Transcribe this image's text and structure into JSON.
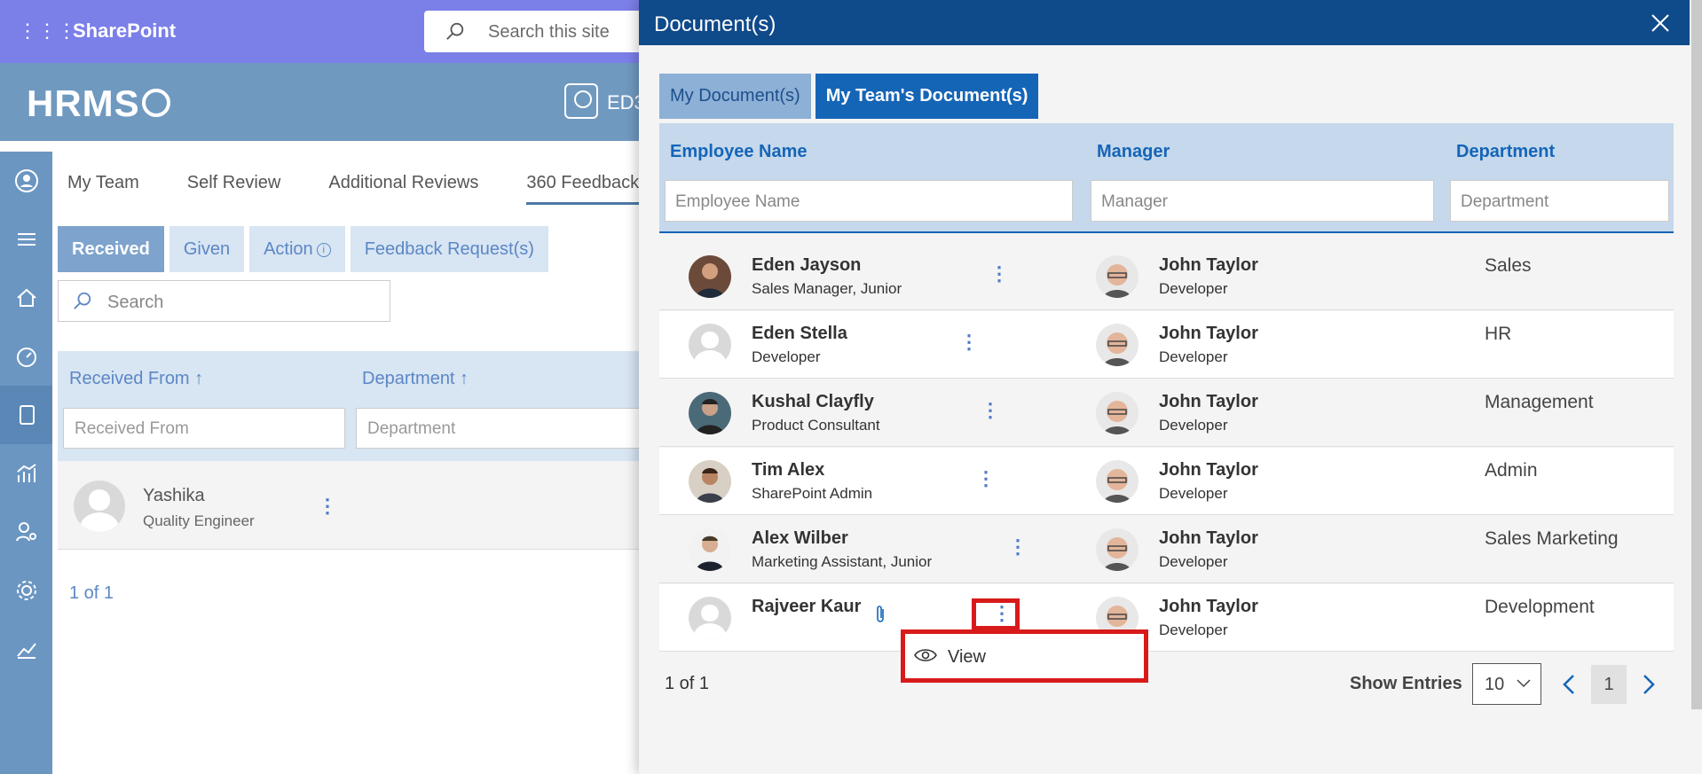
{
  "suitebar": {
    "app_name": "SharePoint",
    "search_placeholder": "Search this site"
  },
  "hrms": {
    "logo_text": "HRMS",
    "badge_text": "ED3"
  },
  "left_tabs": [
    "My Team",
    "Self Review",
    "Additional Reviews",
    "360 Feedback"
  ],
  "sub_tabs": [
    "Received",
    "Given",
    "Action",
    "Feedback Request(s)"
  ],
  "left_search_placeholder": "Search",
  "left_table": {
    "headers": [
      "Received From ↑",
      "Department ↑"
    ],
    "filters": [
      "Received From",
      "Department"
    ],
    "row": {
      "name": "Yashika",
      "role": "Quality Engineer"
    },
    "pagination": "1 of 1"
  },
  "panel": {
    "title": "Document(s)",
    "tabs": [
      "My Document(s)",
      "My Team's Document(s)"
    ],
    "headers": [
      "Employee Name",
      "Manager",
      "Department"
    ],
    "filters": [
      "Employee Name",
      "Manager",
      "Department"
    ],
    "rows": [
      {
        "name": "Eden Jayson",
        "role": "Sales Manager, Junior",
        "manager": "John Taylor",
        "manager_role": "Developer",
        "department": "Sales"
      },
      {
        "name": "Eden Stella",
        "role": "Developer",
        "manager": "John Taylor",
        "manager_role": "Developer",
        "department": "HR"
      },
      {
        "name": "Kushal Clayfly",
        "role": "Product Consultant",
        "manager": "John Taylor",
        "manager_role": "Developer",
        "department": "Management"
      },
      {
        "name": "Tim Alex",
        "role": "SharePoint Admin",
        "manager": "John Taylor",
        "manager_role": "Developer",
        "department": "Admin"
      },
      {
        "name": "Alex Wilber",
        "role": "Marketing Assistant, Junior",
        "manager": "John Taylor",
        "manager_role": "Developer",
        "department": "Sales Marketing"
      },
      {
        "name": "Rajveer Kaur",
        "role": "",
        "manager": "John Taylor",
        "manager_role": "Developer",
        "department": "Development"
      }
    ],
    "context_menu": {
      "view_label": "View"
    },
    "pagination": "1 of 1",
    "show_entries_label": "Show Entries",
    "entries_value": "10",
    "current_page": "1"
  }
}
